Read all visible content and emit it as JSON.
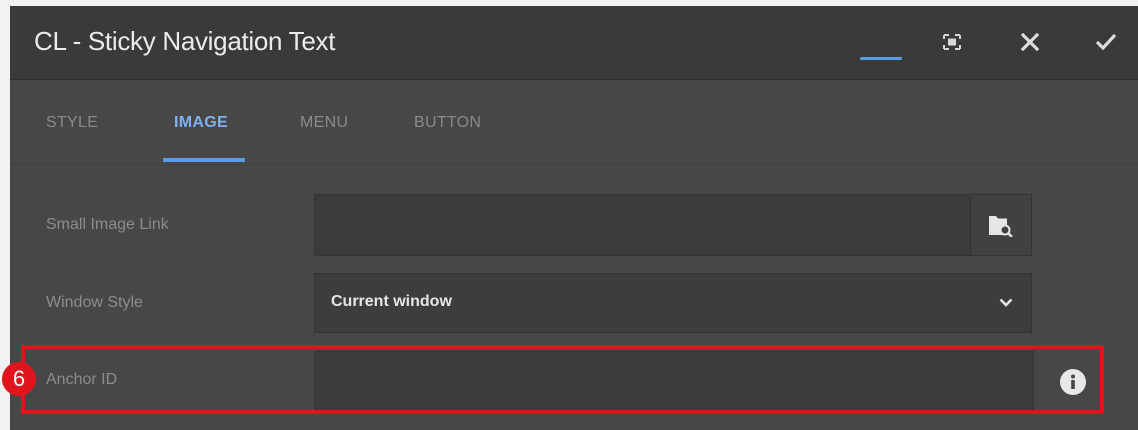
{
  "dialog": {
    "title": "CL - Sticky Navigation Text",
    "controls": {
      "minimize_icon": "minimize-icon",
      "fullscreen_icon": "fullscreen-icon",
      "close_icon": "close-icon",
      "confirm_icon": "checkmark-icon"
    }
  },
  "tabs": [
    {
      "label": "STYLE",
      "active": false
    },
    {
      "label": "IMAGE",
      "active": true
    },
    {
      "label": "MENU",
      "active": false
    },
    {
      "label": "BUTTON",
      "active": false
    }
  ],
  "fields": {
    "small_image_link": {
      "label": "Small Image Link",
      "value": "",
      "button_icon": "folder-search-icon"
    },
    "window_style": {
      "label": "Window Style",
      "value": "Current window",
      "icon": "chevron-down-icon"
    },
    "anchor_id": {
      "label": "Anchor ID",
      "value": "",
      "icon": "info-icon"
    }
  },
  "annotation": {
    "step_number": "6",
    "color": "#e0141c"
  },
  "colors": {
    "accent": "#5a9bea",
    "panel": "#474747",
    "titlebar": "#3a3a3a"
  }
}
